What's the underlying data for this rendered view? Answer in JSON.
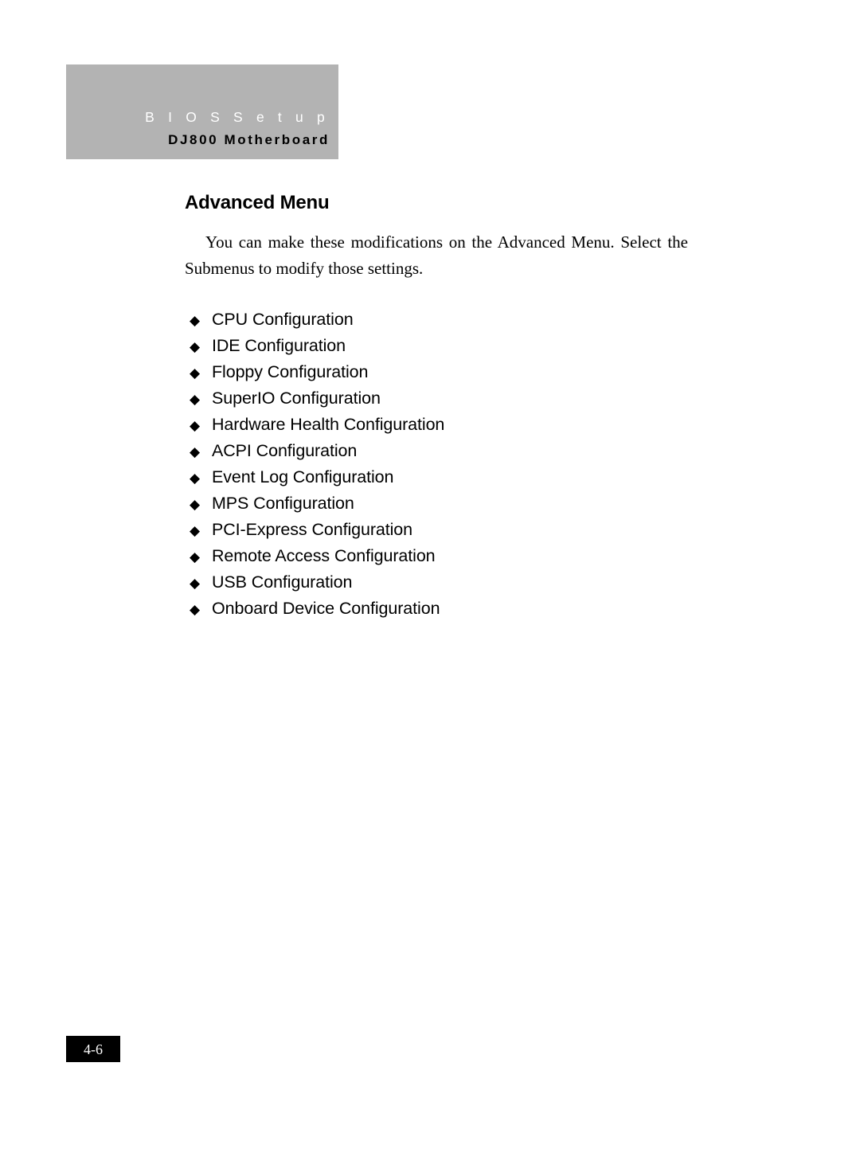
{
  "header": {
    "line1": "B I O S   S e t u p",
    "line2": "DJ800 Motherboard",
    "banner_color": "#b3b3b3",
    "line1_color": "#ffffff",
    "line2_color": "#000000"
  },
  "main": {
    "title": "Advanced Menu",
    "paragraph": "You can make these modifications on the Advanced Menu. Select the Submenus to modify those settings.",
    "bullet_glyph": "◆",
    "items": [
      {
        "label": "CPU Configuration"
      },
      {
        "label": "IDE Configuration"
      },
      {
        "label": "Floppy Configuration"
      },
      {
        "label": "SuperIO Configuration"
      },
      {
        "label": "Hardware Health Configuration"
      },
      {
        "label": "ACPI Configuration"
      },
      {
        "label": "Event Log Configuration"
      },
      {
        "label": "MPS Configuration"
      },
      {
        "label": "PCI-Express Configuration"
      },
      {
        "label": "Remote Access Configuration"
      },
      {
        "label": "USB Configuration"
      },
      {
        "label": "Onboard Device Configuration"
      }
    ]
  },
  "footer": {
    "page_number": "4-6",
    "box_color": "#000000",
    "text_color": "#ffffff"
  }
}
